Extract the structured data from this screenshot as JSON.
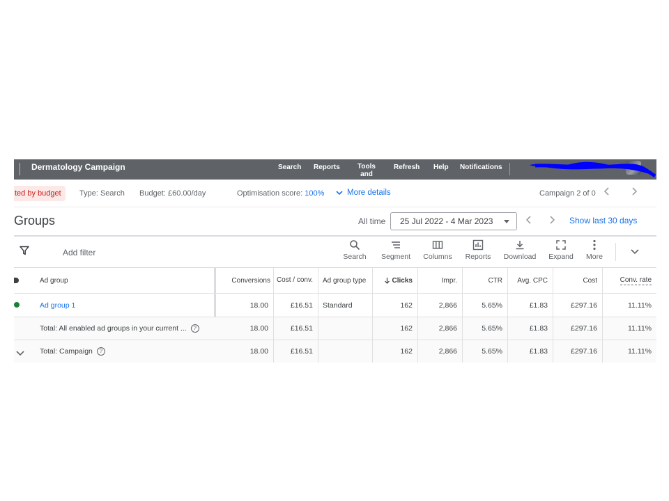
{
  "topbar": {
    "title": "Dermatology Campaign",
    "nav": [
      "Search",
      "Reports",
      "Tools and",
      "Refresh",
      "Help",
      "Notifications"
    ]
  },
  "status": {
    "limited": "ted by budget",
    "type": "Type: Search",
    "budget": "Budget: £60.00/day",
    "opt_label": "Optimisation score:",
    "opt_value": "100%",
    "more_details": "More details",
    "campaign_pos": "Campaign 2 of 0"
  },
  "title": {
    "heading": "Groups",
    "all_time": "All time",
    "date_range": "25 Jul 2022 - 4 Mar 2023",
    "show_last": "Show last 30 days"
  },
  "toolbar": {
    "add_filter": "Add filter",
    "tools": [
      "Search",
      "Segment",
      "Columns",
      "Reports",
      "Download",
      "Expand",
      "More"
    ]
  },
  "table": {
    "headers": {
      "ad_group": "Ad group",
      "conversions": "Conversions",
      "cost_conv": "Cost / conv.",
      "ad_group_type": "Ad group type",
      "clicks": "Clicks",
      "impr": "Impr.",
      "ctr": "CTR",
      "avg_cpc": "Avg. CPC",
      "cost": "Cost",
      "conv_rate": "Conv. rate"
    },
    "rows": [
      {
        "name": "Ad group 1",
        "conversions": "18.00",
        "cost_conv": "£16.51",
        "type": "Standard",
        "clicks": "162",
        "impr": "2,866",
        "ctr": "5.65%",
        "avg_cpc": "£1.83",
        "cost": "£297.16",
        "conv_rate": "11.11%"
      },
      {
        "name": "Total: All enabled ad groups in your current ...",
        "conversions": "18.00",
        "cost_conv": "£16.51",
        "type": "",
        "clicks": "162",
        "impr": "2,866",
        "ctr": "5.65%",
        "avg_cpc": "£1.83",
        "cost": "£297.16",
        "conv_rate": "11.11%"
      },
      {
        "name": "Total: Campaign",
        "conversions": "18.00",
        "cost_conv": "£16.51",
        "type": "",
        "clicks": "162",
        "impr": "2,866",
        "ctr": "5.65%",
        "avg_cpc": "£1.83",
        "cost": "£297.16",
        "conv_rate": "11.11%"
      }
    ]
  },
  "colors": {
    "topbar": "#5f6368",
    "link": "#1a73e8",
    "enabled": "#188038",
    "limited_bg": "#fce8e6",
    "limited_text": "#c5221f",
    "scribble": "#0000ff"
  }
}
